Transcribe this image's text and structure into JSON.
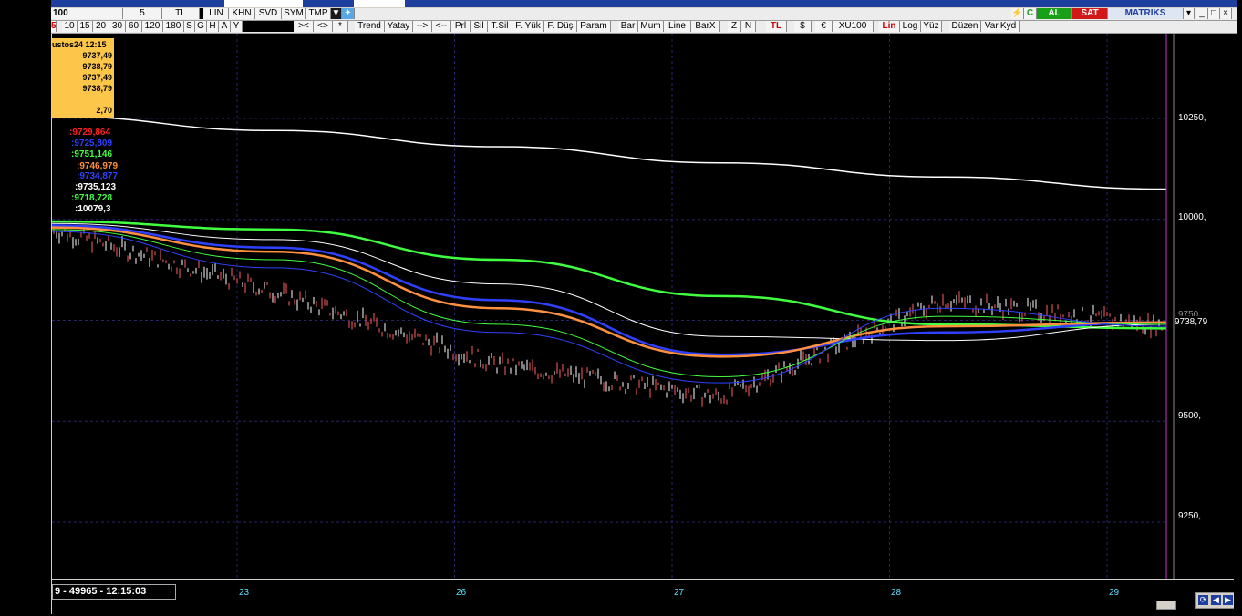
{
  "toolbar_top": {
    "symbol": "100",
    "period": "5",
    "currency": "TL",
    "buttons": [
      "LIN",
      "KHN",
      "SVD",
      "SYM",
      "TMP"
    ],
    "twitter_icon": "twitter-bird-icon",
    "right": {
      "al": "AL",
      "sat": "SAT",
      "brand": "MATRIKS"
    }
  },
  "toolbar_periods": [
    "5",
    "10",
    "15",
    "20",
    "30",
    "60",
    "120",
    "180",
    "S",
    "G",
    "H",
    "A",
    "Y"
  ],
  "toolbar_tools": [
    "><",
    "<>",
    "*",
    "Trend",
    "Yatay",
    "-->",
    "<--",
    "Prl",
    "Sil",
    "T.Sil",
    "F. Yük",
    "F. Düş",
    "Param",
    "Bar",
    "Mum",
    "Line",
    "BarX",
    "Z",
    "N",
    "TL",
    "$",
    "€",
    "XU100",
    "Lin",
    "Log",
    "Yüz",
    "Düzen",
    "Var.Kyd"
  ],
  "info_box": {
    "date": "ustos24 12:15",
    "values": [
      "9737,49",
      "9738,79",
      "9737,49",
      "9738,79"
    ],
    "change": "2,70"
  },
  "legend": [
    {
      "text": ":9729,864",
      "color": "#ff2020"
    },
    {
      "text": ":9725,809",
      "color": "#3040ff"
    },
    {
      "text": ":9751,146",
      "color": "#40ff40"
    },
    {
      "text": ":9746,979",
      "color": "#ff9040"
    },
    {
      "text": ":9734,877",
      "color": "#3040ff"
    },
    {
      "text": ":9735,123",
      "color": "#ffffff"
    },
    {
      "text": ":9718,728",
      "color": "#40ff40"
    },
    {
      "text": ":10079,3",
      "color": "#ffffff"
    }
  ],
  "y_axis": {
    "labels": [
      "10250,",
      "10000,",
      "9750,",
      "9500,",
      "9250,"
    ],
    "current_price": "9738,79"
  },
  "x_axis": {
    "labels": [
      "23",
      "26",
      "27",
      "28",
      "29"
    ]
  },
  "status": {
    "text": "9 - 49965 - 12:15:03"
  },
  "chart_data": {
    "type": "line",
    "y_ticks": [
      10250,
      10000,
      9750,
      9500,
      9250
    ],
    "x_ticks": [
      "23",
      "26",
      "27",
      "28",
      "29"
    ],
    "current_price": 9738.79,
    "ylim": [
      9110,
      10460
    ],
    "series": [
      {
        "color": "#ffffff",
        "values": [
          10255,
          10220,
          10180,
          10140,
          10105,
          10075
        ]
      },
      {
        "color": "#40ff40",
        "values": [
          9995,
          9975,
          9900,
          9810,
          9740,
          9730
        ]
      },
      {
        "color": "#ffffff",
        "values": [
          9990,
          9950,
          9840,
          9710,
          9700,
          9740
        ]
      },
      {
        "color": "#3040ff",
        "values": [
          9985,
          9930,
          9800,
          9665,
          9720,
          9745
        ]
      },
      {
        "color": "#ff9040",
        "values": [
          9980,
          9920,
          9780,
          9660,
          9735,
          9745
        ]
      },
      {
        "color": "#40ff40",
        "values": [
          9975,
          9900,
          9740,
          9610,
          9760,
          9740
        ]
      },
      {
        "color": "#3040ff",
        "values": [
          9970,
          9880,
          9720,
          9595,
          9780,
          9735
        ]
      },
      {
        "color": "#c0c0c0",
        "values": [
          9975,
          9820,
          9640,
          9560,
          9800,
          9735
        ]
      }
    ]
  }
}
